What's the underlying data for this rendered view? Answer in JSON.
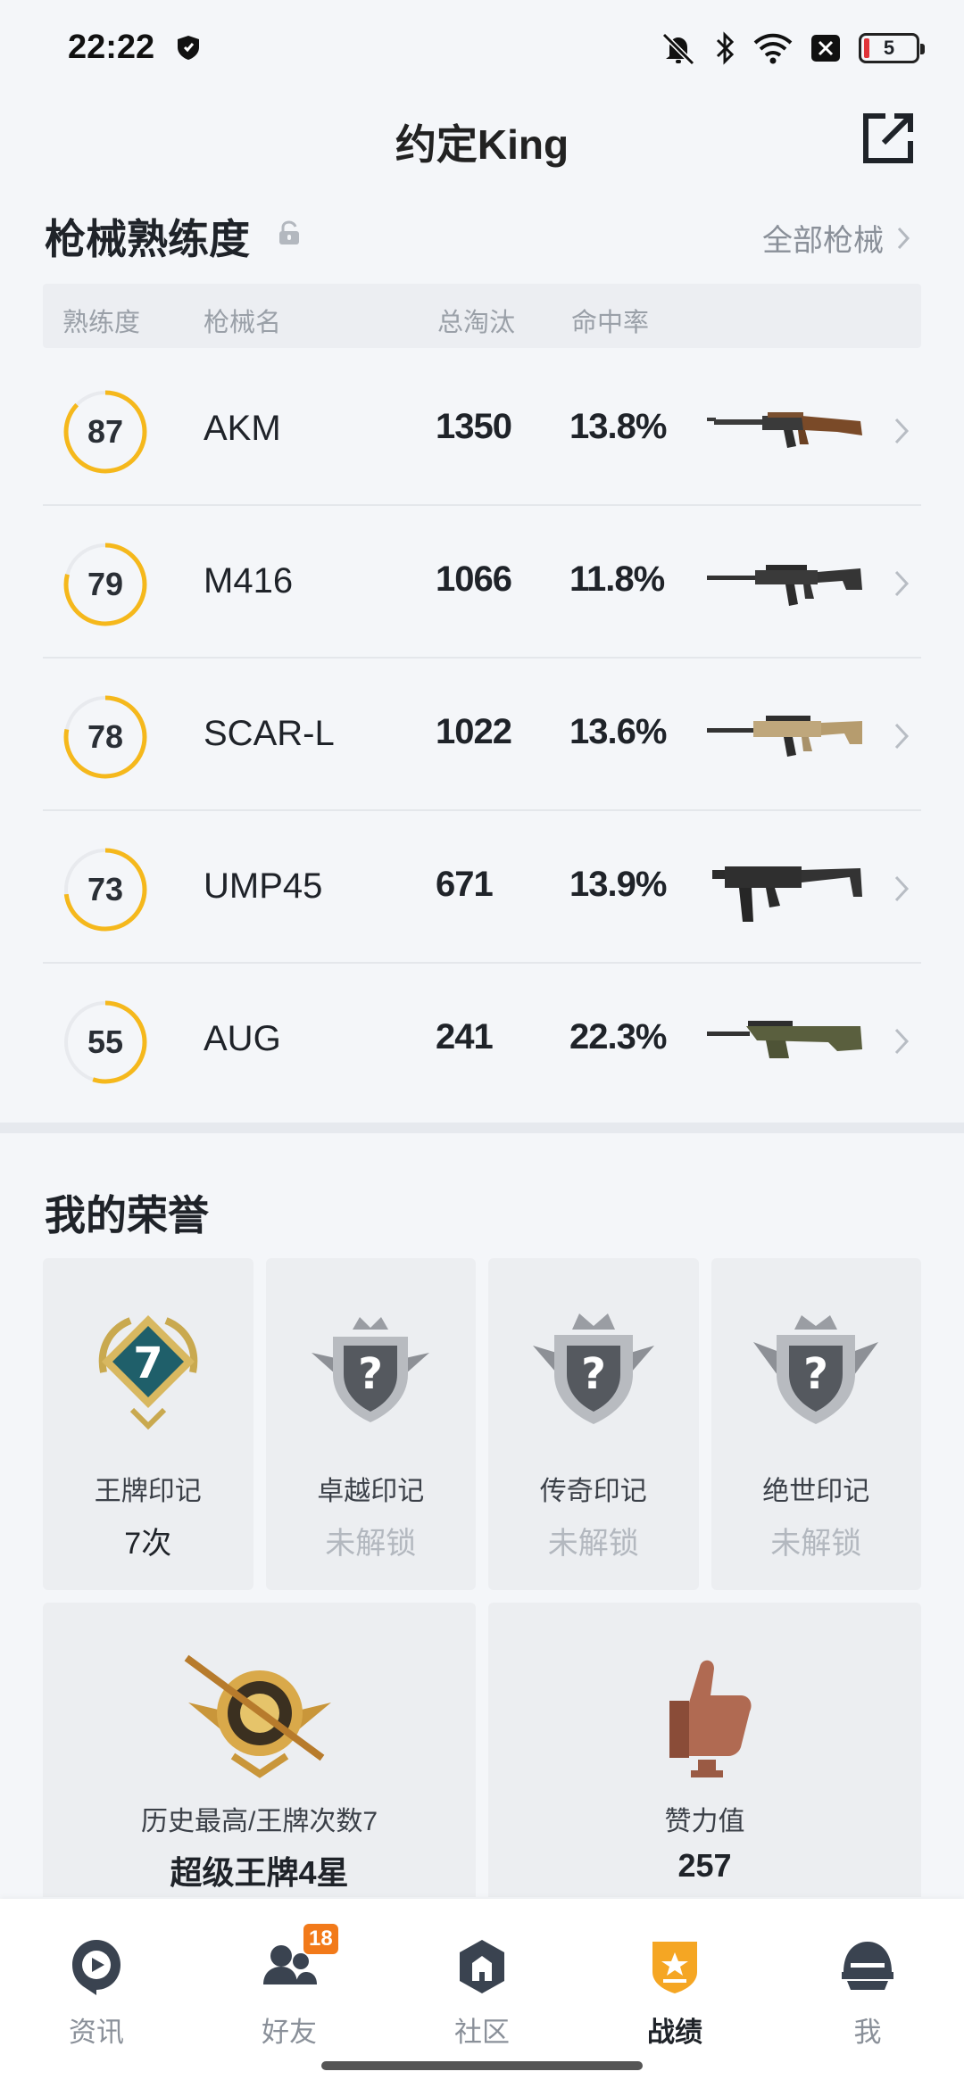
{
  "status_bar": {
    "time": "22:22",
    "battery": "5"
  },
  "header": {
    "title": "约定King"
  },
  "mastery": {
    "title": "枪械熟练度",
    "all_link": "全部枪械",
    "columns": [
      "熟练度",
      "枪械名",
      "总淘汰",
      "命中率"
    ],
    "weapons": [
      {
        "mastery": "87",
        "mastery_value": 87,
        "name": "AKM",
        "eliminations": "1350",
        "accuracy": "13.8%"
      },
      {
        "mastery": "79",
        "mastery_value": 79,
        "name": "M416",
        "eliminations": "1066",
        "accuracy": "11.8%"
      },
      {
        "mastery": "78",
        "mastery_value": 78,
        "name": "SCAR-L",
        "eliminations": "1022",
        "accuracy": "13.6%"
      },
      {
        "mastery": "73",
        "mastery_value": 73,
        "name": "UMP45",
        "eliminations": "671",
        "accuracy": "13.9%"
      },
      {
        "mastery": "55",
        "mastery_value": 55,
        "name": "AUG",
        "eliminations": "241",
        "accuracy": "22.3%"
      }
    ],
    "ring_color": "#f5b81c"
  },
  "honors": {
    "title": "我的荣誉",
    "marks": [
      {
        "name": "王牌印记",
        "value": "7次",
        "badge": "7"
      },
      {
        "name": "卓越印记",
        "value": "未解锁",
        "badge": "?"
      },
      {
        "name": "传奇印记",
        "value": "未解锁",
        "badge": "?"
      },
      {
        "name": "绝世印记",
        "value": "未解锁",
        "badge": "?"
      }
    ],
    "best": {
      "label": "历史最高/王牌次数7",
      "value": "超级王牌4星"
    },
    "likes": {
      "label": "赞力值",
      "value": "257"
    }
  },
  "nav": {
    "items": [
      {
        "label": "资讯",
        "icon": "news-icon"
      },
      {
        "label": "好友",
        "icon": "friends-icon",
        "badge": "18"
      },
      {
        "label": "社区",
        "icon": "community-icon"
      },
      {
        "label": "战绩",
        "icon": "record-icon",
        "active": true
      },
      {
        "label": "我",
        "icon": "helmet-icon"
      }
    ]
  }
}
